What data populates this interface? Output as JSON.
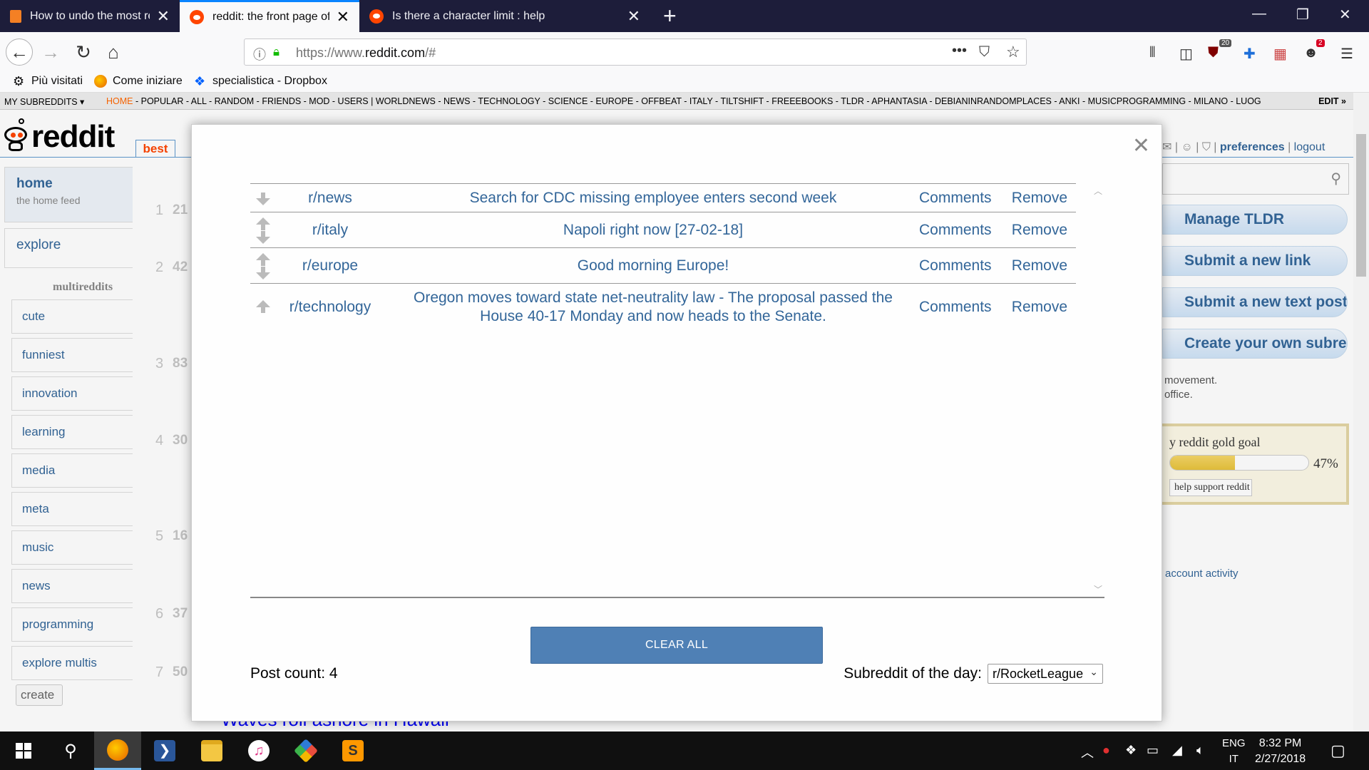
{
  "browser": {
    "tabs": [
      {
        "title": "How to undo the most recent c",
        "icon": "stackoverflow-icon",
        "active": false
      },
      {
        "title": "reddit: the front page of the int",
        "icon": "reddit-icon",
        "active": true
      },
      {
        "title": "Is there a character limit : help",
        "icon": "reddit-icon",
        "active": false
      }
    ],
    "url_prefix": "https://www.",
    "url_domain": "reddit.com",
    "url_suffix": "/#",
    "toolbar_badges": {
      "ublock": "20",
      "addon": "2"
    },
    "bookmarks": [
      "Più visitati",
      "Come iniziare",
      "specialistica - Dropbox"
    ]
  },
  "reddit": {
    "sr_bar": {
      "my_subreddits": "MY SUBREDDITS",
      "home": "HOME",
      "links_rest": " - POPULAR - ALL - RANDOM - FRIENDS - MOD - USERS  |  WORLDNEWS - NEWS - TECHNOLOGY - SCIENCE - EUROPE - OFFBEAT - ITALY - TILTSHIFT - FREEEBOOKS - TLDR - APHANTASIA - DEBIANINRANDOMPLACES - ANKI - MUSICPROGRAMMING - MILANO - LUOG",
      "edit": "EDIT »"
    },
    "logo_text": "reddit",
    "sort_tab": "best",
    "user_links": {
      "preferences": "preferences",
      "logout": "logout"
    },
    "left_nav": {
      "home": {
        "title": "home",
        "subtitle": "the home feed"
      },
      "explore": "explore",
      "multireddits_heading": "multireddits",
      "multireddits": [
        "cute",
        "funniest",
        "innovation",
        "learning",
        "media",
        "meta",
        "music",
        "news",
        "programming",
        "explore multis"
      ],
      "create": "create"
    },
    "background_posts": [
      {
        "rank": "1",
        "score": "21"
      },
      {
        "rank": "2",
        "score": "42"
      },
      {
        "rank": "3",
        "score": "83"
      },
      {
        "rank": "4",
        "score": "30"
      },
      {
        "rank": "5",
        "score": "16"
      },
      {
        "rank": "6",
        "score": "37"
      },
      {
        "rank": "7",
        "score": "50"
      }
    ],
    "bottom_post_title": "Waves roll ashore in Hawaii",
    "sidebar": {
      "buttons": [
        "Manage TLDR",
        "Submit a new link",
        "Submit a new text post",
        "Create your own subreddit"
      ],
      "text_lines": [
        "movement.",
        "office."
      ],
      "gold_goal_title": "y reddit gold goal",
      "gold_goal_fraction": 0.47,
      "gold_goal_percent": "47%",
      "help_support": "help support reddit",
      "account_activity": "account activity"
    }
  },
  "modal": {
    "posts": [
      {
        "subreddit": "r/news",
        "title": "Search for CDC missing employee enters second week",
        "comments": "Comments",
        "remove": "Remove",
        "votes": "down"
      },
      {
        "subreddit": "r/italy",
        "title": "Napoli right now [27-02-18]",
        "comments": "Comments",
        "remove": "Remove",
        "votes": "both"
      },
      {
        "subreddit": "r/europe",
        "title": "Good morning Europe!",
        "comments": "Comments",
        "remove": "Remove",
        "votes": "both"
      },
      {
        "subreddit": "r/technology",
        "title": "Oregon moves toward state net-neutrality law - The proposal passed the House 40-17 Monday and now heads to the Senate.",
        "comments": "Comments",
        "remove": "Remove",
        "votes": "up"
      }
    ],
    "clear_all": "CLEAR ALL",
    "post_count": "Post count: 4",
    "subreddit_of_day_label": "Subreddit of the day:",
    "subreddit_of_day_value": "r/RocketLeague"
  },
  "taskbar": {
    "lang_top": "ENG",
    "lang_bottom": "IT",
    "time": "8:32 PM",
    "date": "2/27/2018"
  },
  "colors": {
    "accent_link": "#336699",
    "clear_button": "#4f80b5",
    "reddit_orange": "#ff4500"
  }
}
